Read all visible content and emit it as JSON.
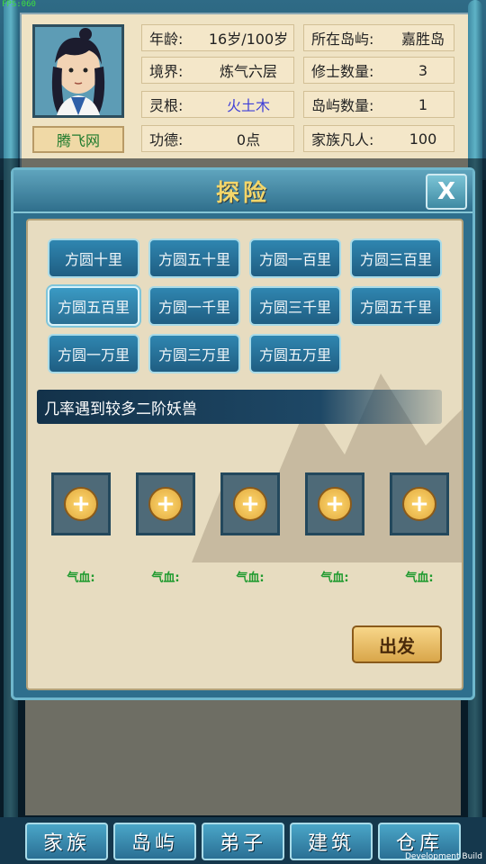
{
  "fps": "FPS:060",
  "profile": {
    "name": "腾飞网",
    "rows": [
      {
        "label": "年龄:",
        "value": "16岁/100岁"
      },
      {
        "label": "境界:",
        "value": "炼气六层"
      },
      {
        "label": "灵根:",
        "value": "火土木"
      },
      {
        "label": "功德:",
        "value": "0点"
      }
    ],
    "rows_right": [
      {
        "label": "所在岛屿:",
        "value": "嘉胜岛"
      },
      {
        "label": "修士数量:",
        "value": "3"
      },
      {
        "label": "岛屿数量:",
        "value": "1"
      },
      {
        "label": "家族凡人:",
        "value": "100"
      }
    ]
  },
  "dialog": {
    "title": "探险",
    "close_label": "X",
    "ranges": [
      "方圆十里",
      "方圆五十里",
      "方圆一百里",
      "方圆三百里",
      "方圆五百里",
      "方圆一千里",
      "方圆三千里",
      "方圆五千里",
      "方圆一万里",
      "方圆三万里",
      "方圆五万里"
    ],
    "description": "几率遇到较多二阶妖兽",
    "slots": [
      {
        "hp_label": "气血:"
      },
      {
        "hp_label": "气血:"
      },
      {
        "hp_label": "气血:"
      },
      {
        "hp_label": "气血:"
      },
      {
        "hp_label": "气血:"
      }
    ],
    "go_label": "出发"
  },
  "nav": [
    "家族",
    "岛屿",
    "弟子",
    "建筑",
    "仓库"
  ],
  "dev_build": "Development Build"
}
